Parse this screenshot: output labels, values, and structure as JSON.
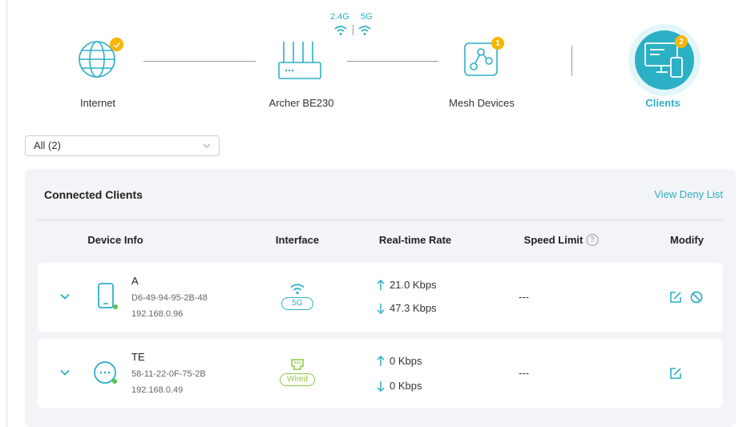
{
  "topology": {
    "internet": {
      "label": "Internet"
    },
    "router": {
      "label": "Archer BE230",
      "band_24": "2.4G",
      "band_5": "5G"
    },
    "mesh": {
      "label": "Mesh Devices",
      "badge": "1"
    },
    "clients": {
      "label": "Clients",
      "badge": "2"
    }
  },
  "filter": {
    "value": "All (2)"
  },
  "panel": {
    "title": "Connected Clients",
    "deny_link": "View Deny List",
    "headers": {
      "device_info": "Device Info",
      "interface": "Interface",
      "rate": "Real-time Rate",
      "speed_limit": "Speed Limit",
      "help_glyph": "?",
      "modify": "Modify"
    }
  },
  "clients": [
    {
      "name": "A",
      "mac": "D6-49-94-95-2B-48",
      "ip": "192.168.0.96",
      "device_type": "phone-icon",
      "interface": "5G",
      "interface_icon": "wifi-icon",
      "up_rate": "21.0 Kbps",
      "down_rate": "47.3 Kbps",
      "speed_limit": "---"
    },
    {
      "name": "TE",
      "mac": "58-11-22-0F-75-2B",
      "ip": "192.168.0.49",
      "device_type": "generic-device-icon",
      "interface": "Wired",
      "interface_icon": "ethernet-icon",
      "up_rate": "0 Kbps",
      "down_rate": "0 Kbps",
      "speed_limit": "---"
    }
  ],
  "colors": {
    "accent": "#2cb0c5",
    "badge": "#f7b500",
    "wired": "#8cc63f",
    "online": "#5cc04a",
    "panel_bg": "#f3f4f7"
  }
}
